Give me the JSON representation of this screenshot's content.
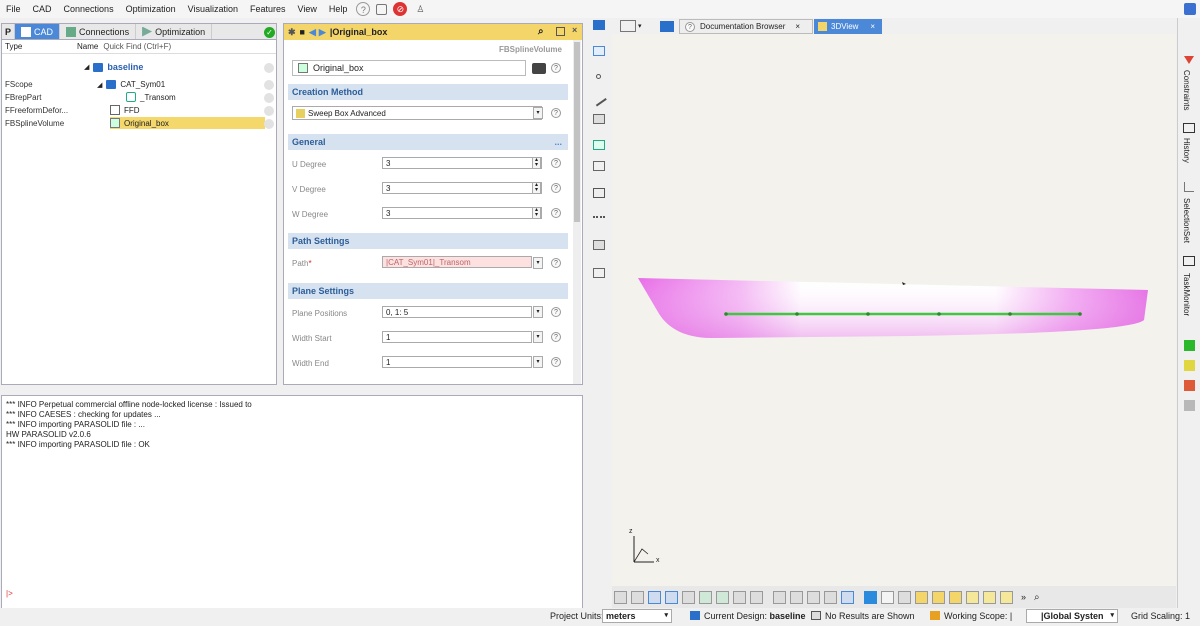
{
  "menu": [
    "File",
    "CAD",
    "Connections",
    "Optimization",
    "Visualization",
    "Features",
    "View",
    "Help"
  ],
  "left_panel": {
    "tabs": [
      {
        "label": "CAD"
      },
      {
        "label": "Connections"
      },
      {
        "label": "Optimization"
      }
    ],
    "col_type": "Type",
    "col_name": "Name",
    "quick_find": "Quick Find (Ctrl+F)",
    "types": [
      "FScope",
      "FBrepPart",
      "FFreeformDefor...",
      "FBSplineVolume"
    ],
    "tree": {
      "root": "baseline",
      "items": [
        "CAT_Sym01",
        "_Transom",
        "FFD",
        "Original_box"
      ]
    }
  },
  "mid_panel": {
    "title": "|Original_box",
    "class_name": "FBSplineVolume",
    "object_name": "Original_box",
    "sections": {
      "creation": "Creation Method",
      "general": "General",
      "path": "Path Settings",
      "plane": "Plane Settings"
    },
    "creation_value": "Sweep Box Advanced",
    "general_more": "...",
    "params": {
      "u_label": "U Degree",
      "u_value": "3",
      "v_label": "V Degree",
      "v_value": "3",
      "w_label": "W Degree",
      "w_value": "3",
      "path_label": "Path",
      "path_value": "|CAT_Sym01|_Transom",
      "planepos_label": "Plane Positions",
      "planepos_value": "0, 1: 5",
      "widthstart_label": "Width Start",
      "widthstart_value": "1",
      "widthend_label": "Width End",
      "widthend_value": "1"
    }
  },
  "console": {
    "lines": [
      "*** INFO Perpetual commercial offline node-locked license : Issued to",
      "*** INFO CAESES : checking for updates ...",
      "*** INFO importing PARASOLID file : ...",
      "HW PARASOLID v2.0.6",
      "*** INFO importing PARASOLID file : OK"
    ],
    "prompt": "|>"
  },
  "view": {
    "tabs": [
      {
        "label": "Documentation Browser"
      },
      {
        "label": "3DView"
      }
    ],
    "axis_z": "z",
    "axis_x": "x"
  },
  "right_tabs": [
    "Constraints",
    "History",
    "SelectionSet",
    "TaskMonitor"
  ],
  "status": {
    "units_label": "Project Units:",
    "units_value": "meters",
    "design_label": "Current Design:",
    "design_value": "baseline",
    "results": "No Results are Shown",
    "scope_label": "Working Scope: |",
    "system": "|Global Systen",
    "scaling": "Grid Scaling: 1"
  },
  "colors": {
    "accent": "#4b89d8",
    "title_yellow": "#f3d56a",
    "hull_magenta": "#e86ee8",
    "green": "#3fc83f"
  }
}
